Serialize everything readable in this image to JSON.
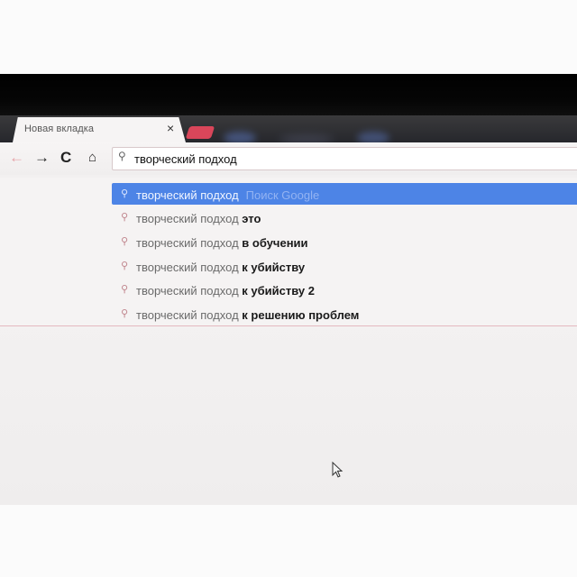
{
  "tab": {
    "title": "Новая вкладка",
    "close": "×"
  },
  "nav": {
    "back": "←",
    "forward": "→",
    "reload": "C",
    "home": "⌂"
  },
  "omnibox": {
    "value": "творческий подход",
    "icon": "search-icon"
  },
  "suggestions": [
    {
      "base": "творческий подход",
      "bold": "",
      "hint": "Поиск Google",
      "selected": true
    },
    {
      "base": "творческий подход",
      "bold": "это",
      "hint": "",
      "selected": false
    },
    {
      "base": "творческий подход",
      "bold": "в обучении",
      "hint": "",
      "selected": false
    },
    {
      "base": "творческий подход",
      "bold": "к убийству",
      "hint": "",
      "selected": false
    },
    {
      "base": "творческий подход",
      "bold": "к убийству 2",
      "hint": "",
      "selected": false
    },
    {
      "base": "творческий подход",
      "bold": "к решению проблем",
      "hint": "",
      "selected": false
    }
  ],
  "colors": {
    "selection": "#4d84e6",
    "new_tab": "#d9465a",
    "tabstrip": "#26272c"
  }
}
